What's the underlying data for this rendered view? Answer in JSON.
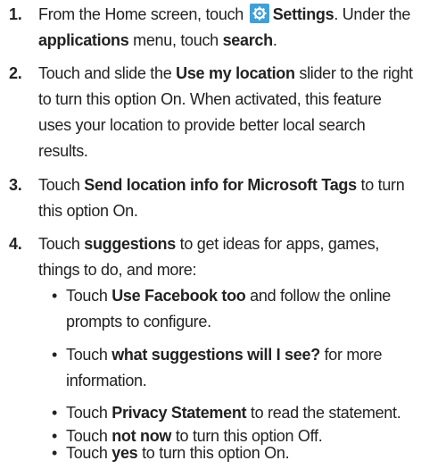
{
  "steps": [
    {
      "number": "1.",
      "lines": [
        {
          "a": "From the Home screen, touch ",
          "icon": "settings-gear-icon",
          "b": "Settings",
          "c": ". Under the"
        },
        {
          "a": "applications",
          "b": " menu, touch ",
          "c": "search",
          "d": "."
        }
      ]
    },
    {
      "number": "2.",
      "lines": [
        "Touch and slide the ",
        "Use my location",
        " slider to the right",
        "to turn this option On. When activated, this feature",
        "uses your location to provide better local search",
        "results."
      ]
    },
    {
      "number": "3.",
      "lines": [
        "Touch ",
        "Send location info for Microsoft Tags",
        " to turn",
        "this option On."
      ]
    },
    {
      "number": "4.",
      "lines": [
        "Touch ",
        "suggestions",
        " to get ideas for apps, games,",
        "things to do, and more:"
      ]
    }
  ],
  "bullets": [
    {
      "pre": "Touch ",
      "bold": "Use Facebook too",
      "post": " and follow the online",
      "line2": "prompts to configure."
    },
    {
      "pre": "Touch ",
      "bold": "what suggestions will I see?",
      "post": " for more",
      "line2": "information."
    },
    {
      "pre": "Touch ",
      "bold": "Privacy Statement",
      "post": " to read the statement."
    },
    {
      "pre": "Touch ",
      "bold": "not now",
      "post": " to turn this option Off."
    },
    {
      "pre": "Touch ",
      "bold": "yes",
      "post": " to turn this option On."
    }
  ],
  "bullet_char": "•",
  "colors": {
    "icon_bg": "#3fa0d8",
    "text": "#222222"
  }
}
